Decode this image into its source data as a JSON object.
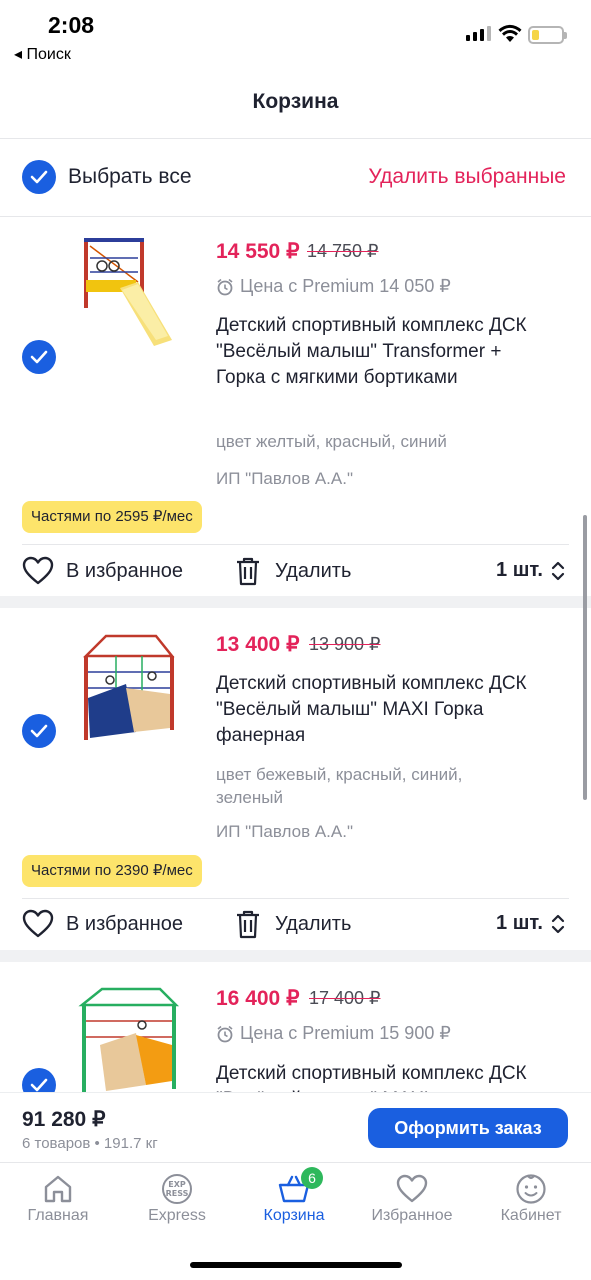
{
  "status_bar": {
    "time": "2:08",
    "back_label": "◂ Поиск"
  },
  "header": {
    "title": "Корзина"
  },
  "select_all": {
    "label": "Выбрать все",
    "delete_label": "Удалить выбранные"
  },
  "products": [
    {
      "price": "14 550 ₽",
      "old_price": "14 750 ₽",
      "premium": "Цена с Premium 14 050 ₽",
      "title": "Детский спортивный комплекс ДСК \"Весёлый малыш\" Transformer + Горка с мягкими бортиками",
      "color": "цвет желтый, красный, синий",
      "seller": "ИП \"Павлов А.А.\"",
      "installment": "Частями по 2595 ₽/мес",
      "favorite_label": "В избранное",
      "delete_label": "Удалить",
      "quantity": "1 шт."
    },
    {
      "price": "13 400 ₽",
      "old_price": "13 900 ₽",
      "title": "Детский спортивный комплекс ДСК \"Весёлый малыш\" MAXI Горка фанерная",
      "color": "цвет бежевый, красный, синий, зеленый",
      "seller": "ИП \"Павлов А.А.\"",
      "installment": "Частями по 2390 ₽/мес",
      "favorite_label": "В избранное",
      "delete_label": "Удалить",
      "quantity": "1 шт."
    },
    {
      "price": "16 400 ₽",
      "old_price": "17 400 ₽",
      "premium": "Цена с Premium 15 900 ₽",
      "title": "Детский спортивный комплекс ДСК \"Весёлый малыш\" MAXI"
    }
  ],
  "summary": {
    "total": "91 280 ₽",
    "details": "6 товаров • 191.7 кг",
    "order_button": "Оформить заказ"
  },
  "tabs": [
    {
      "label": "Главная",
      "icon": "home-icon"
    },
    {
      "label": "Express",
      "icon": "express-icon"
    },
    {
      "label": "Корзина",
      "icon": "basket-icon",
      "badge": "6",
      "active": true
    },
    {
      "label": "Избранное",
      "icon": "heart-icon"
    },
    {
      "label": "Кабинет",
      "icon": "profile-icon"
    }
  ],
  "colors": {
    "accent_blue": "#1a5fe0",
    "price_red": "#e3235a",
    "badge_green": "#2eb85c",
    "installment_yellow": "#fde46b"
  }
}
